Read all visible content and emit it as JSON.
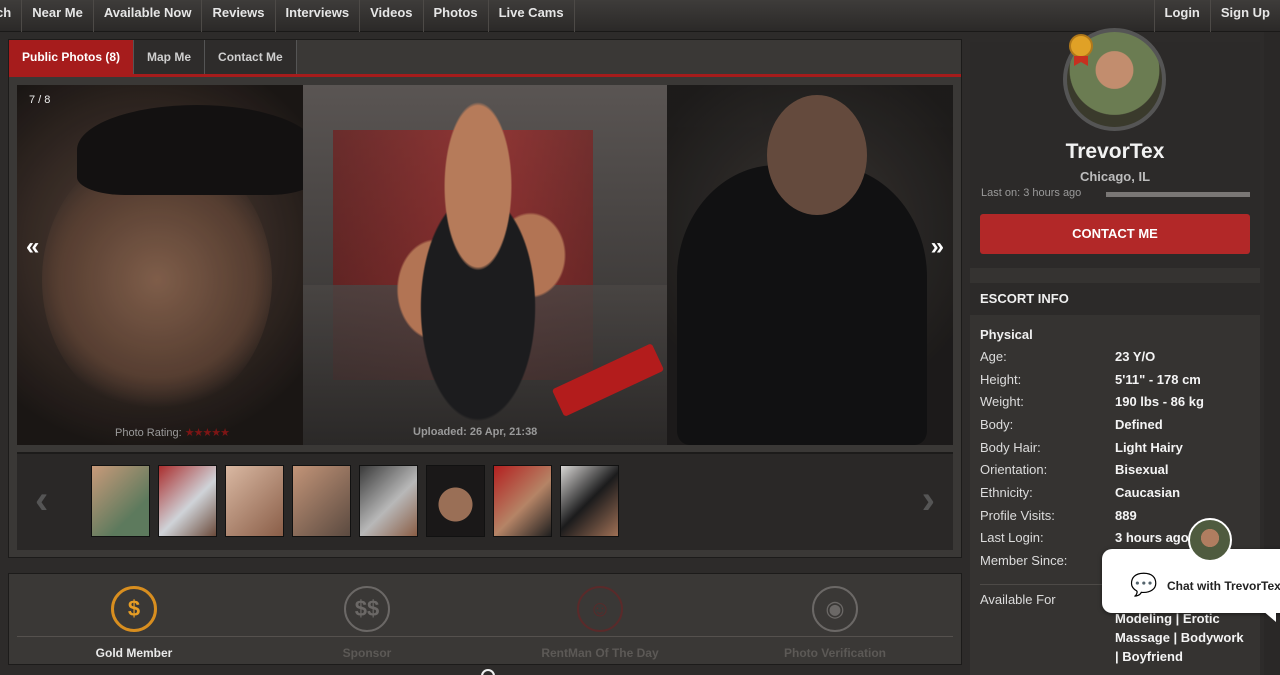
{
  "nav": {
    "items": [
      "rch",
      "Near Me",
      "Available Now",
      "Reviews",
      "Interviews",
      "Videos",
      "Photos",
      "Live Cams"
    ],
    "login": "Login",
    "signup": "Sign Up"
  },
  "tabs": [
    "Public Photos (8)",
    "Map Me",
    "Contact Me"
  ],
  "viewer": {
    "counter": "7 / 8",
    "prev": "«",
    "next": "»",
    "rating_label": "Photo Rating:",
    "rating_stars": "★★★★★",
    "uploaded": "Uploaded: 26 Apr, 21:38"
  },
  "thumbs": {
    "prev": "‹",
    "next": "›",
    "count": 8
  },
  "badges": [
    {
      "label": "Gold Member",
      "icon": "$"
    },
    {
      "label": "Sponsor",
      "icon": "$$"
    },
    {
      "label": "RentMan Of The Day",
      "icon": "☺"
    },
    {
      "label": "Photo Verification",
      "icon": "◉"
    }
  ],
  "profile": {
    "username": "TrevorTex",
    "location": "Chicago, IL",
    "last_on": "Last on: 3 hours ago",
    "contact_button": "CONTACT ME"
  },
  "escort_info": {
    "heading": "ESCORT INFO",
    "section": "Physical",
    "rows": [
      {
        "k": "Age:",
        "v": "23 Y/O"
      },
      {
        "k": "Height:",
        "v": "5'11\" - 178 cm"
      },
      {
        "k": "Weight:",
        "v": "190 lbs - 86 kg"
      },
      {
        "k": "Body:",
        "v": "Defined"
      },
      {
        "k": "Body Hair:",
        "v": "Light Hairy"
      },
      {
        "k": "Orientation:",
        "v": "Bisexual"
      },
      {
        "k": "Ethnicity:",
        "v": "Caucasian"
      },
      {
        "k": "Profile Visits:",
        "v": "889"
      },
      {
        "k": "Last Login:",
        "v": "3 hours ago"
      },
      {
        "k": "Member Since:",
        "v": ""
      }
    ],
    "available_for_label": "Available For",
    "available_for_value": "Modeling | Erotic Massage | Bodywork | Boyfriend"
  },
  "chat": {
    "label": "Chat with TrevorTex"
  },
  "colors": {
    "accent": "#b22828",
    "gold": "#d88e1f"
  }
}
